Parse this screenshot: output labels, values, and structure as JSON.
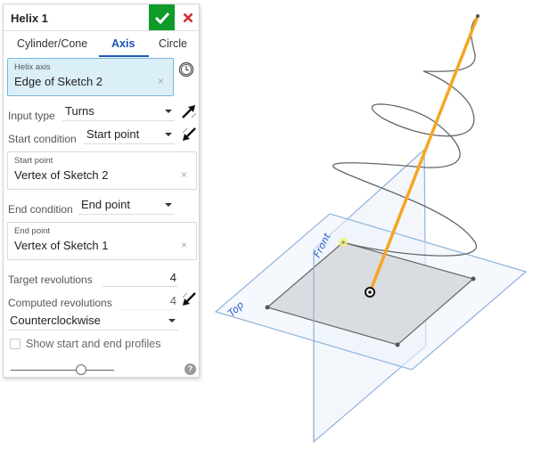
{
  "dialog": {
    "title": "Helix 1",
    "ok_icon": "checkmark-icon",
    "cancel_icon": "close-icon",
    "colors": {
      "ok": "#0f9b29",
      "cancel": "#d32f2f",
      "accent": "#1a56b8",
      "selection_bg": "#dbeff9"
    }
  },
  "tabs": [
    {
      "label": "Cylinder/Cone",
      "active": false
    },
    {
      "label": "Axis",
      "active": true
    },
    {
      "label": "Circle",
      "active": false
    }
  ],
  "helix_axis": {
    "label": "Helix axis",
    "value": "Edge of Sketch 2",
    "clear": "×",
    "history_icon": "clock-icon"
  },
  "input_type": {
    "label": "Input type",
    "value": "Turns",
    "icon": "direction-arrow-icon"
  },
  "start_condition": {
    "label": "Start condition",
    "value": "Start point",
    "icon": "flip-direction-icon"
  },
  "start_point": {
    "label": "Start point",
    "value": "Vertex of Sketch 2",
    "clear": "×"
  },
  "end_condition": {
    "label": "End condition",
    "value": "End point"
  },
  "end_point": {
    "label": "End point",
    "value": "Vertex of Sketch 1",
    "clear": "×"
  },
  "target_revolutions": {
    "label": "Target revolutions",
    "value": "4"
  },
  "computed_revolutions": {
    "label": "Computed revolutions",
    "value": "4",
    "icon": "flip-direction-icon"
  },
  "direction": {
    "value": "Counterclockwise"
  },
  "show_profiles": {
    "label": "Show start and end profiles",
    "checked": false
  },
  "slider": {
    "value_fraction": 0.7
  },
  "help": {
    "glyph": "?"
  },
  "viewport": {
    "planes": {
      "top": "Top",
      "front": "Front"
    },
    "colors": {
      "axis": "#f5a623",
      "helix": "#666666",
      "plane": "#7ba6d4",
      "sketch": "#d6d9dd"
    }
  }
}
